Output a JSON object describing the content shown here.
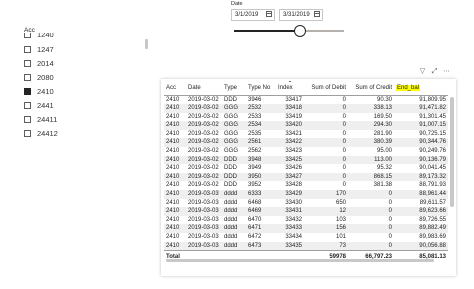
{
  "acc_slicer": {
    "title": "Acc",
    "items": [
      {
        "label": "1240",
        "checked": false
      },
      {
        "label": "1247",
        "checked": false
      },
      {
        "label": "2014",
        "checked": false
      },
      {
        "label": "2080",
        "checked": false
      },
      {
        "label": "2410",
        "checked": true
      },
      {
        "label": "2441",
        "checked": false
      },
      {
        "label": "24411",
        "checked": false
      },
      {
        "label": "24412",
        "checked": false
      }
    ]
  },
  "date_slicer": {
    "title": "Date",
    "start": "3/1/2019",
    "end": "3/31/2019"
  },
  "table": {
    "headers": [
      "Acc",
      "Date",
      "Type",
      "Type No",
      "Index",
      "Sum of Debit",
      "Sum of Credit",
      "End_bal"
    ],
    "rows": [
      [
        "2410",
        "2019-03-02",
        "DDD",
        "3946",
        "33417",
        "0",
        "90.30",
        "91,809.95"
      ],
      [
        "2410",
        "2019-03-02",
        "GGG",
        "2532",
        "33418",
        "0",
        "338.13",
        "91,471.82"
      ],
      [
        "2410",
        "2019-03-02",
        "GGG",
        "2533",
        "33419",
        "0",
        "169.50",
        "91,301.45"
      ],
      [
        "2410",
        "2019-03-02",
        "GGG",
        "2534",
        "33420",
        "0",
        "294.30",
        "91,007.15"
      ],
      [
        "2410",
        "2019-03-02",
        "GGG",
        "2535",
        "33421",
        "0",
        "281.90",
        "90,725.15"
      ],
      [
        "2410",
        "2019-03-02",
        "GGG",
        "2561",
        "33422",
        "0",
        "380.39",
        "90,344.76"
      ],
      [
        "2410",
        "2019-03-02",
        "GGG",
        "2562",
        "33423",
        "0",
        "95.00",
        "90,249.76"
      ],
      [
        "2410",
        "2019-03-02",
        "DDD",
        "3948",
        "33425",
        "0",
        "113.00",
        "90,136.79"
      ],
      [
        "2410",
        "2019-03-02",
        "DDD",
        "3949",
        "33426",
        "0",
        "95.32",
        "90,041.45"
      ],
      [
        "2410",
        "2019-03-02",
        "DDD",
        "3950",
        "33427",
        "0",
        "868.15",
        "89,173.32"
      ],
      [
        "2410",
        "2019-03-02",
        "DDD",
        "3952",
        "33428",
        "0",
        "381.38",
        "88,791.93"
      ],
      [
        "2410",
        "2019-03-03",
        "dddd",
        "6333",
        "33429",
        "170",
        "0",
        "88,961.44"
      ],
      [
        "2410",
        "2019-03-03",
        "dddd",
        "6468",
        "33430",
        "650",
        "0",
        "89,611.57"
      ],
      [
        "2410",
        "2019-03-03",
        "dddd",
        "6469",
        "33431",
        "12",
        "0",
        "89,623.66"
      ],
      [
        "2410",
        "2019-03-03",
        "dddd",
        "6470",
        "33432",
        "103",
        "0",
        "89,726.55"
      ],
      [
        "2410",
        "2019-03-03",
        "dddd",
        "6471",
        "33433",
        "156",
        "0",
        "89,882.49"
      ],
      [
        "2410",
        "2019-03-03",
        "dddd",
        "6472",
        "33434",
        "101",
        "0",
        "89,983.69"
      ],
      [
        "2410",
        "2019-03-03",
        "dddd",
        "6473",
        "33435",
        "73",
        "0",
        "90,056.88"
      ]
    ],
    "total": {
      "label": "Total",
      "debit": "59978",
      "credit": "66,797.23",
      "end_bal": "85,081.13"
    }
  }
}
